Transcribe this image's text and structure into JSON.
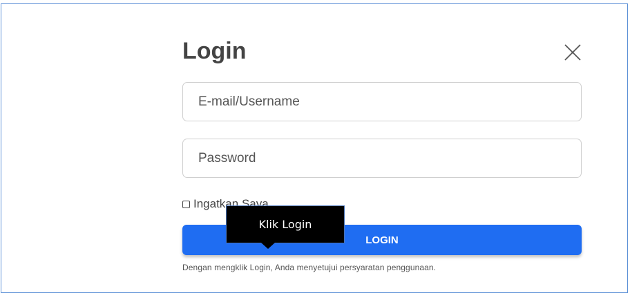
{
  "dialog": {
    "title": "Login",
    "close_icon": "close-icon"
  },
  "form": {
    "email_placeholder": "E-mail/Username",
    "password_placeholder": "Password",
    "remember_label": "Ingatkan Saya",
    "login_label": "LOGIN",
    "terms_text": "Dengan mengklik Login, Anda menyetujui persyaratan penggunaan."
  },
  "annotation": {
    "callout_text": "Klik Login"
  },
  "colors": {
    "primary": "#1f6df2",
    "frame_border": "#5b8fd6",
    "callout_bg": "#000000"
  }
}
